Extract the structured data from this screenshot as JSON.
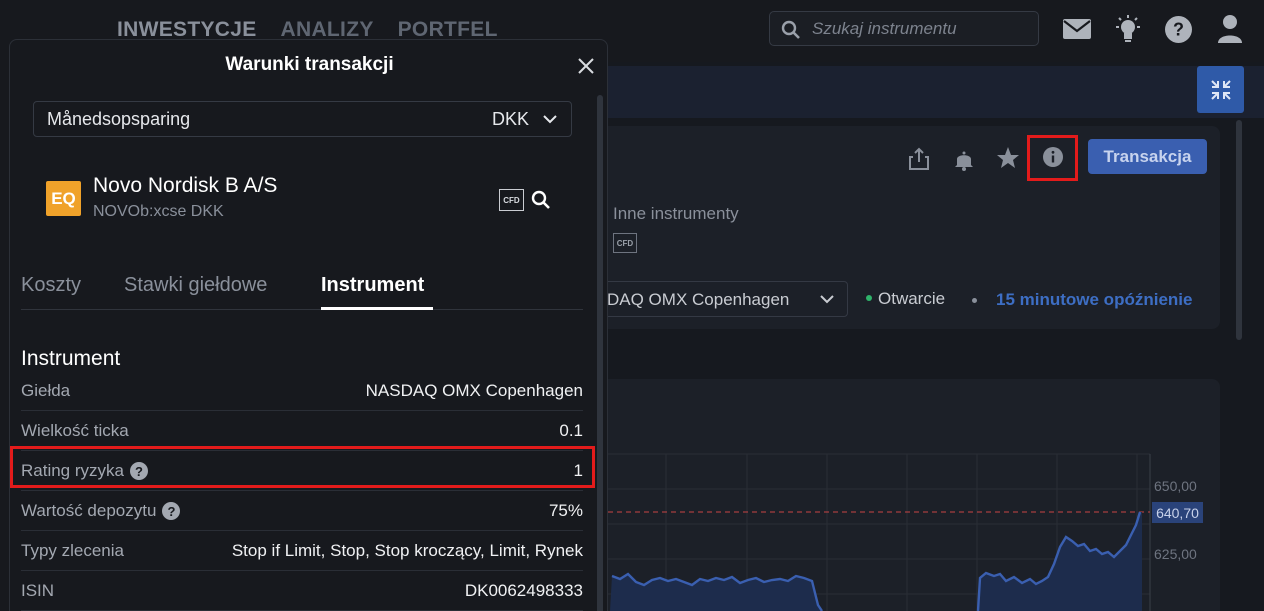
{
  "topbar": {
    "nav": [
      "INWESTYCJE",
      "ANALIZY",
      "PORTFEL"
    ],
    "search_placeholder": "Szukaj instrumentu"
  },
  "instrument_page": {
    "other_instruments_label": "Inne instrumenty",
    "cfd_label": "CFD",
    "exchange_value": "DAQ OMX Copenhagen",
    "status": "Otwarcie",
    "delay": "15 minutowe opóźnienie",
    "transaction_button": "Transakcja"
  },
  "chart": {
    "y_labels": [
      "650,00",
      "625,00"
    ],
    "current_price": "640,70"
  },
  "modal": {
    "title": "Warunki transakcji",
    "account": "Månedsopsparing",
    "currency": "DKK",
    "instrument": {
      "badge": "EQ",
      "name": "Novo Nordisk B A/S",
      "symbol": "NOVOb:xcse DKK",
      "cfd": "CFD"
    },
    "tabs": [
      "Koszty",
      "Stawki giełdowe",
      "Instrument"
    ],
    "section_title": "Instrument",
    "rows": [
      {
        "label": "Giełda",
        "value": "NASDAQ OMX Copenhagen"
      },
      {
        "label": "Wielkość ticka",
        "value": "0.1"
      },
      {
        "label": "Rating ryzyka",
        "value": "1"
      },
      {
        "label": "Wartość depozytu",
        "value": "75%"
      },
      {
        "label": "Typy zlecenia",
        "value": "Stop if Limit, Stop, Stop kroczący, Limit, Rynek"
      },
      {
        "label": "ISIN",
        "value": "DK0062498333"
      }
    ]
  },
  "colors": {
    "accent": "#3a5fb0",
    "highlight": "#e31b1b",
    "eq_badge": "#f0a22a",
    "chart_line": "#3a5fb0"
  }
}
